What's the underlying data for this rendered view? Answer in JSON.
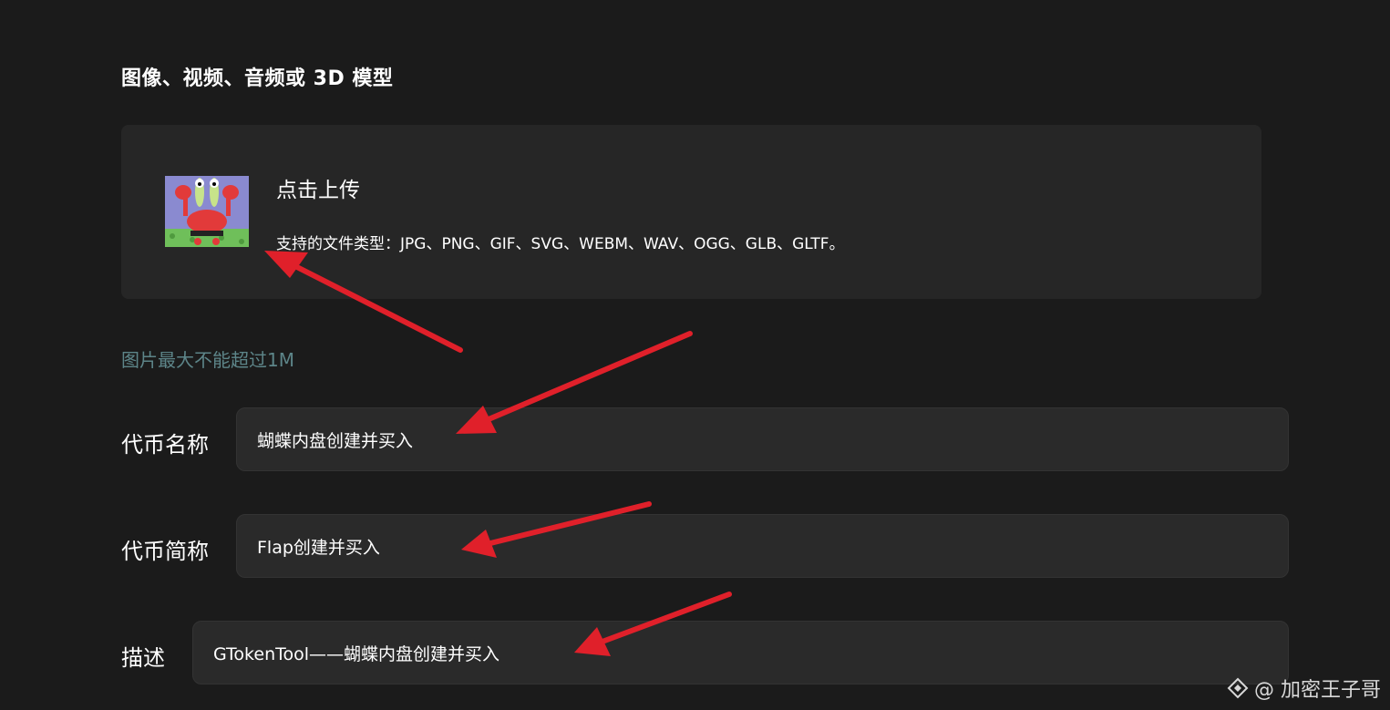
{
  "section": {
    "title": "图像、视频、音频或 3D 模型"
  },
  "upload": {
    "label": "点击上传",
    "hint": "支持的文件类型：JPG、PNG、GIF、SVG、WEBM、WAV、OGG、GLB、GLTF。"
  },
  "size_note": "图片最大不能超过1M",
  "fields": {
    "token_name": {
      "label": "代币名称",
      "value": "蝴蝶内盘创建并买入"
    },
    "token_symbol": {
      "label": "代币简称",
      "value": "Flap创建并买入"
    },
    "description": {
      "label": "描述",
      "value": "GTokenTool——蝴蝶内盘创建并买入"
    }
  },
  "annotations": {
    "arrow_color": "#e0202a"
  },
  "watermark": {
    "text": "@ 加密王子哥",
    "icon": "diamond-logo-icon"
  },
  "colors": {
    "background": "#1b1b1b",
    "panel": "#262626",
    "input": "#2a2a2a",
    "note": "#5d8589"
  }
}
